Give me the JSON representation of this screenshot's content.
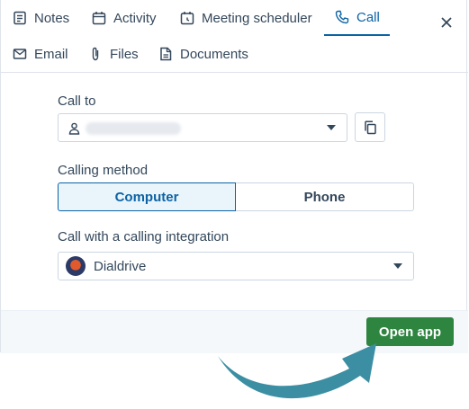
{
  "tabs": [
    {
      "label": "Notes",
      "icon": "notes-icon"
    },
    {
      "label": "Activity",
      "icon": "calendar-icon"
    },
    {
      "label": "Meeting scheduler",
      "icon": "meeting-icon"
    },
    {
      "label": "Call",
      "icon": "phone-icon",
      "active": true
    },
    {
      "label": "Email",
      "icon": "email-icon"
    },
    {
      "label": "Files",
      "icon": "paperclip-icon"
    },
    {
      "label": "Documents",
      "icon": "document-icon"
    }
  ],
  "call_to": {
    "label": "Call to",
    "icon": "person-icon"
  },
  "calling_method": {
    "label": "Calling method",
    "options": [
      "Computer",
      "Phone"
    ],
    "selected": "Computer"
  },
  "integration": {
    "label": "Call with a calling integration",
    "value": "Dialdrive",
    "icon": "dialdrive-logo"
  },
  "footer": {
    "open_app_label": "Open app"
  },
  "colors": {
    "accent": "#0b63a5",
    "primary_button": "#2e8540",
    "annotation_arrow": "#3c8ea3"
  }
}
